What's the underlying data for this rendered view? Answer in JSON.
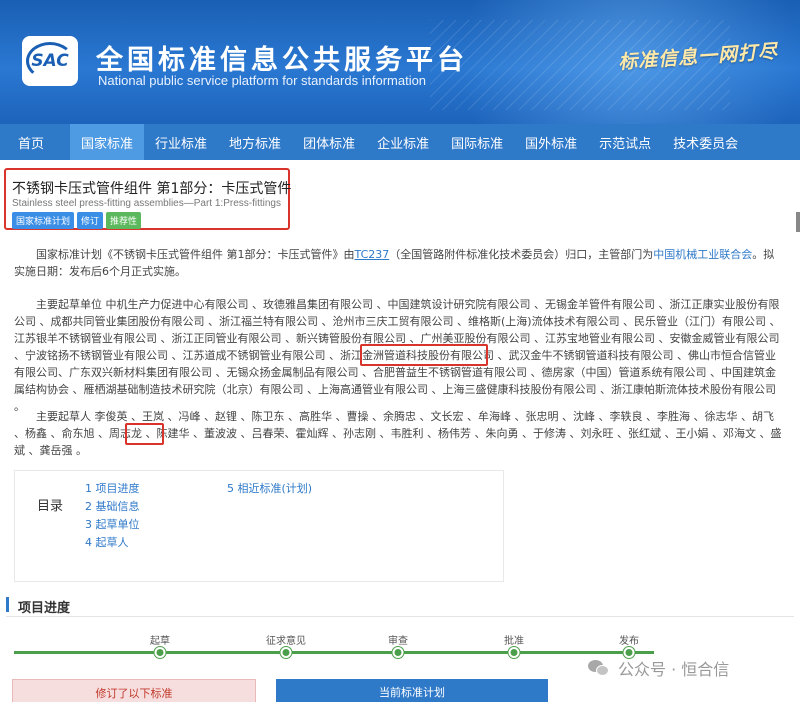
{
  "header": {
    "logo_text": "SAC",
    "title": "全国标准信息公共服务平台",
    "subtitle": "National public service platform  for standards information",
    "slogan": "标准信息一网打尽"
  },
  "nav": {
    "items": [
      {
        "label": "首页"
      },
      {
        "label": "国家标准",
        "active": true
      },
      {
        "label": "行业标准"
      },
      {
        "label": "地方标准"
      },
      {
        "label": "团体标准"
      },
      {
        "label": "企业标准"
      },
      {
        "label": "国际标准"
      },
      {
        "label": "国外标准"
      },
      {
        "label": "示范试点"
      },
      {
        "label": "技术委员会"
      }
    ]
  },
  "standard": {
    "title": "不锈钢卡压式管件组件 第1部分：卡压式管件",
    "title_en": "Stainless steel press-fitting assemblies—Part 1:Press-fittings",
    "tags": [
      "国家标准计划",
      "修订",
      "推荐性"
    ]
  },
  "intro": {
    "p1_a": "国家标准计划《不锈钢卡压式管件组件 第1部分：卡压式管件》由",
    "p1_tc": "TC237",
    "p1_b": "（全国管路附件标准化技术委员会）归口，主管部门为",
    "p1_dept": "中国机械工业联合会",
    "p1_c": "。拟实施日期：发布后6个月正式实施。"
  },
  "units": {
    "p2_a": "主要起草单位 中机生产力促进中心有限公司 、玫德雅昌集团有限公司 、中国建筑设计研究院有限公司 、无锡金羊管件有限公司 、浙江正康实业股份有限公司 、成都共同管业集团股份有限公司 、浙江福兰特有限公司 、沧州市三庆工贸有限公司 、维格斯(上海)流体技术有限公司 、民乐管业（江门）有限公司 、江苏银羊不锈钢管业有限公司 、浙江正同管业有限公司 、新兴铸管股份有限公司 、广州美亚股份有限公司 、江苏宝地管业有限公司 、安徽金威管业有限公司 、宁波铭扬不锈钢管业有限公司 、江苏道成不锈钢管业有限公司 、浙江金洲管道科技股份有限公司 、武汉金牛不锈钢管道科技有限公司 、",
    "p2_hl": "佛山市恒合信管业有限公司",
    "p2_b": "、广东双兴新材料集团有限公司 、无锡众扬金属制品有限公司 、合肥普益生不锈钢管道有限公司 、德房家（中国）管道系统有限公司 、中国建筑金属结构协会 、雁栖湖基础制造技术研究院（北京）有限公司 、上海高通管业有限公司 、上海三盛健康科技股份有限公司 、浙江康帕斯流体技术股份有限公司 。"
  },
  "drafters": {
    "p3_a": "主要起草人 李俊英 、王岚 、冯峰 、赵锂 、陈卫东 、高胜华 、曹操 、余腾忠 、文长宏 、牟海峰 、张忠明 、沈峰 、李轶良 、李胜海 、徐志华 、胡飞 、杨鑫 、俞东旭 、周志龙 、陈建华 、董波波 、",
    "p3_hl": "吕春荣",
    "p3_b": "、霍灿辉 、孙志刚 、韦胜利 、杨伟芳 、朱向勇 、于修涛 、刘永旺 、张红斌 、王小娟 、邓海文 、盛斌 、龚岳强 。"
  },
  "toc": {
    "label": "目录",
    "items": [
      "1  项目进度",
      "2  基础信息",
      "3  起草单位",
      "4  起草人",
      "5  相近标准(计划)"
    ]
  },
  "progress": {
    "title": "项目进度",
    "steps": [
      "起草",
      "征求意见",
      "审查",
      "批准",
      "发布"
    ],
    "completed_steps": 5
  },
  "watermark": "公众号 · 恒合信",
  "buttons": {
    "revised": "修订了以下标准",
    "current": "当前标准计划"
  }
}
